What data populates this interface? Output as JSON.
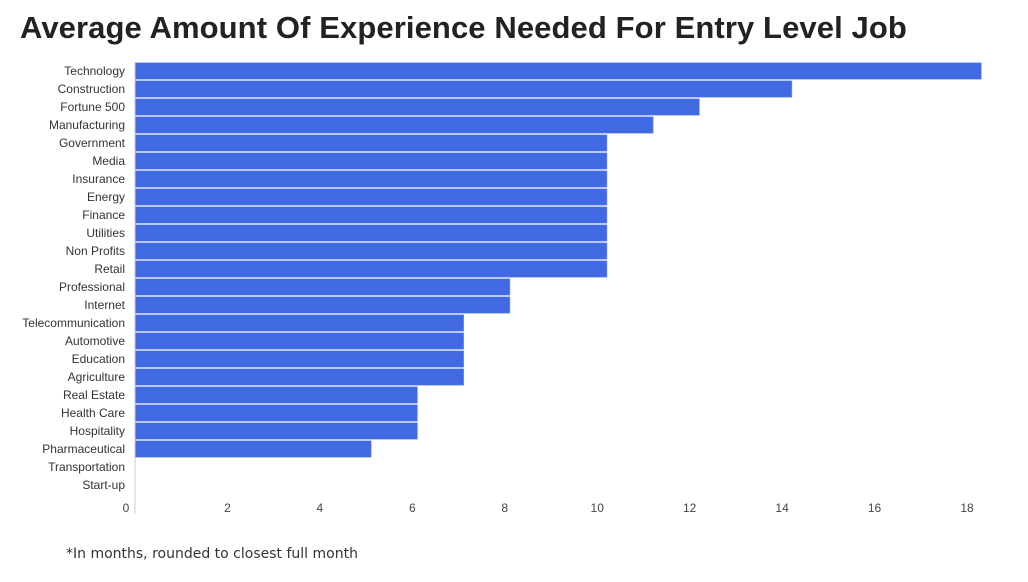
{
  "chart_data": {
    "type": "bar",
    "orientation": "horizontal",
    "title": "Average Amount Of Experience Needed For Entry Level Job",
    "footnote": "*In months, rounded to closest full month",
    "xlabel": "",
    "ylabel": "",
    "xlim": [
      0,
      18.3
    ],
    "xticks": [
      0,
      2,
      4,
      6,
      8,
      10,
      12,
      14,
      16,
      18
    ],
    "grid": false,
    "bar_color": "#4169e1",
    "categories": [
      "Technology",
      "Construction",
      "Fortune 500",
      "Manufacturing",
      "Government",
      "Media",
      "Insurance",
      "Energy",
      "Finance",
      "Utilities",
      "Non Profits",
      "Retail",
      "Professional",
      "Internet",
      "Telecommunication",
      "Automotive",
      "Education",
      "Agriculture",
      "Real Estate",
      "Health Care",
      "Hospitality",
      "Pharmaceutical",
      "Transportation",
      "Start-up"
    ],
    "values": [
      18.3,
      14.2,
      12.2,
      11.2,
      10.2,
      10.2,
      10.2,
      10.2,
      10.2,
      10.2,
      10.2,
      10.2,
      8.1,
      8.1,
      7.1,
      7.1,
      7.1,
      7.1,
      6.1,
      6.1,
      6.1,
      5.1,
      0,
      0
    ]
  }
}
